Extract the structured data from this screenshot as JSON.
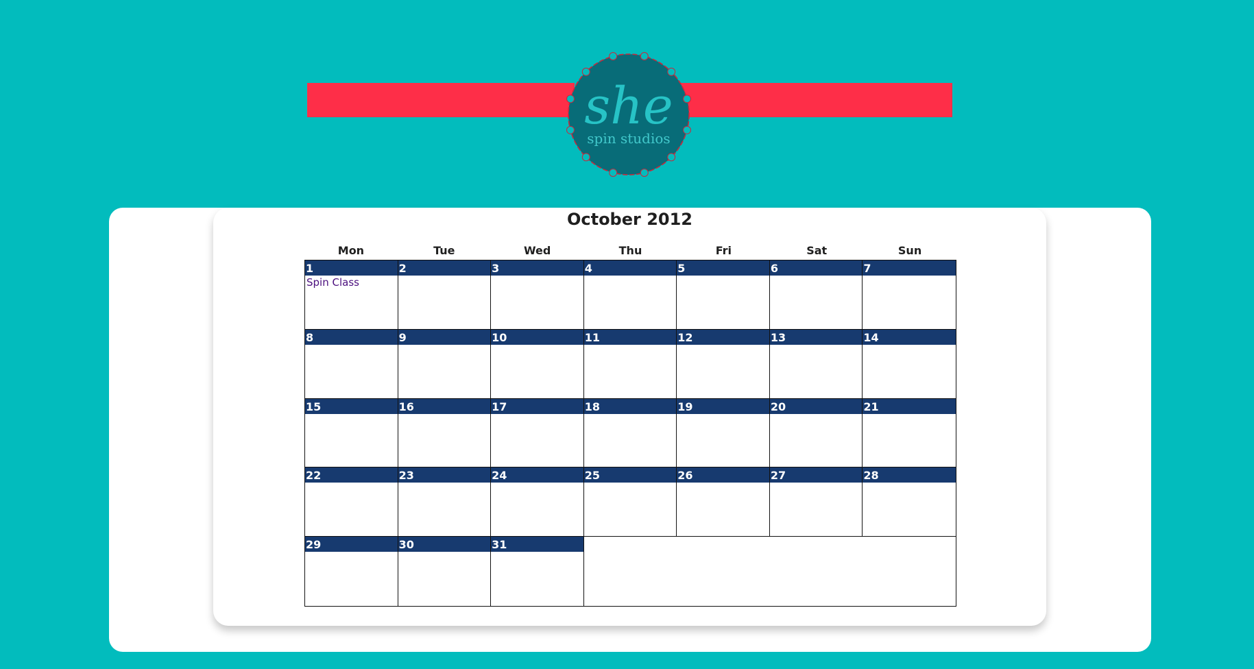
{
  "brand": {
    "logo_text": "she",
    "logo_subtext": "spin studios",
    "colors": {
      "background": "#02bcbd",
      "banner": "#fe2e48",
      "badge": "#086c78",
      "badge_text": "#27c3c6"
    }
  },
  "calendar": {
    "title": "October 2012",
    "weekdays": [
      "Mon",
      "Tue",
      "Wed",
      "Thu",
      "Fri",
      "Sat",
      "Sun"
    ],
    "header_color": "#173a6f",
    "event_color": "#4b0f7e",
    "days": [
      {
        "date": "1",
        "events": [
          "Spin Class"
        ]
      },
      {
        "date": "2",
        "events": []
      },
      {
        "date": "3",
        "events": []
      },
      {
        "date": "4",
        "events": []
      },
      {
        "date": "5",
        "events": []
      },
      {
        "date": "6",
        "events": []
      },
      {
        "date": "7",
        "events": []
      },
      {
        "date": "8",
        "events": []
      },
      {
        "date": "9",
        "events": []
      },
      {
        "date": "10",
        "events": []
      },
      {
        "date": "11",
        "events": []
      },
      {
        "date": "12",
        "events": []
      },
      {
        "date": "13",
        "events": []
      },
      {
        "date": "14",
        "events": []
      },
      {
        "date": "15",
        "events": []
      },
      {
        "date": "16",
        "events": []
      },
      {
        "date": "17",
        "events": []
      },
      {
        "date": "18",
        "events": []
      },
      {
        "date": "19",
        "events": []
      },
      {
        "date": "20",
        "events": []
      },
      {
        "date": "21",
        "events": []
      },
      {
        "date": "22",
        "events": []
      },
      {
        "date": "23",
        "events": []
      },
      {
        "date": "24",
        "events": []
      },
      {
        "date": "25",
        "events": []
      },
      {
        "date": "26",
        "events": []
      },
      {
        "date": "27",
        "events": []
      },
      {
        "date": "28",
        "events": []
      },
      {
        "date": "29",
        "events": []
      },
      {
        "date": "30",
        "events": []
      },
      {
        "date": "31",
        "events": []
      }
    ]
  }
}
